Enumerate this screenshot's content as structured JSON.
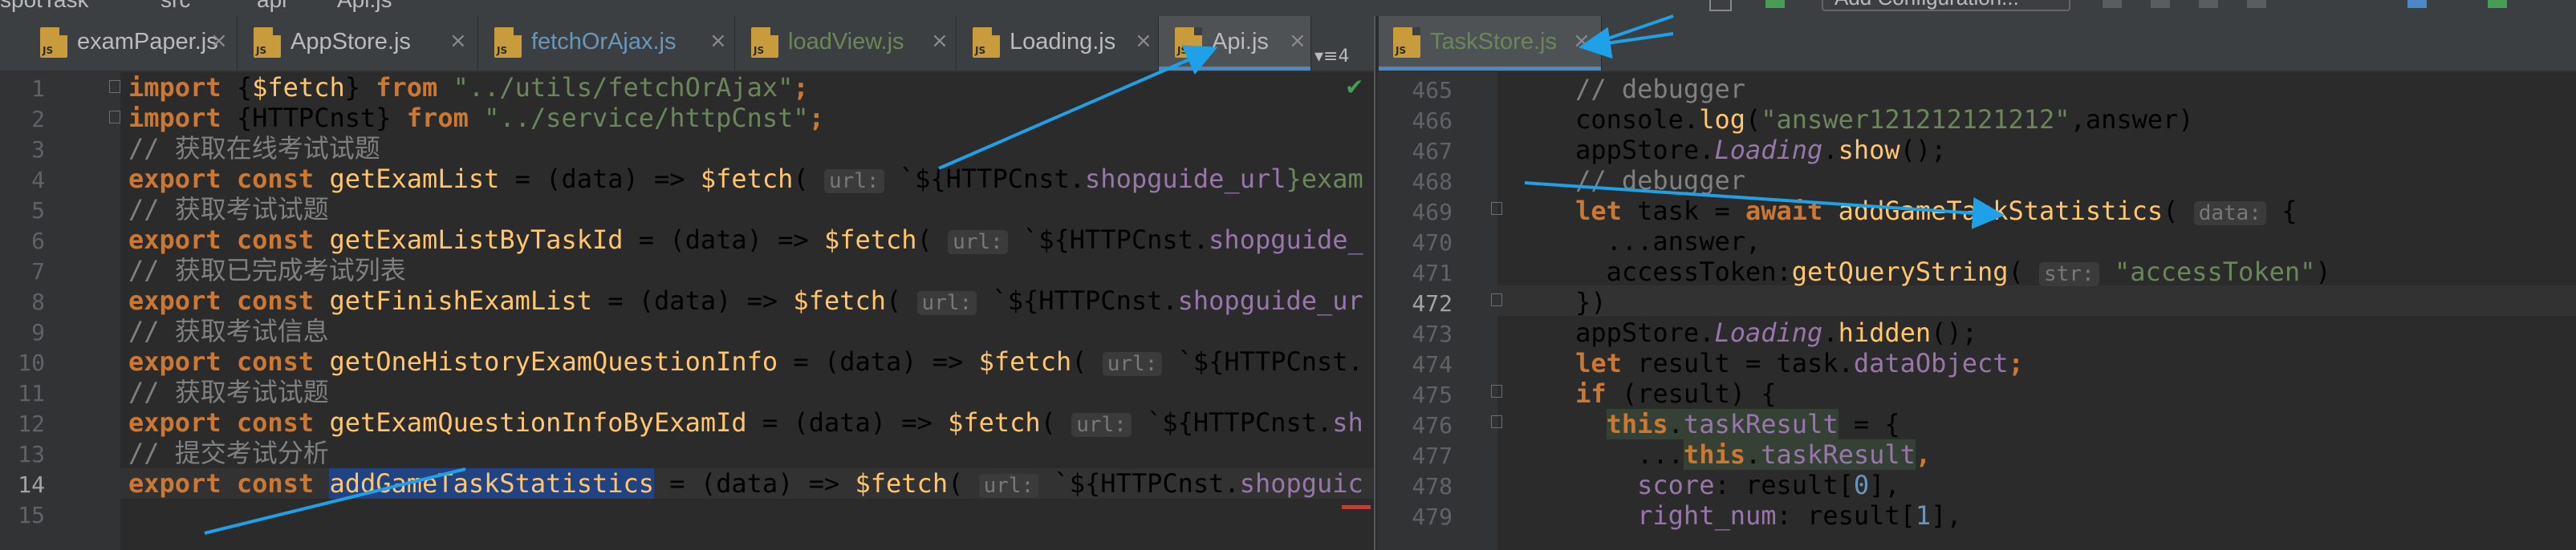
{
  "title_bar": {
    "crumbs": [
      "spotTask",
      "src",
      "api",
      "Api.js"
    ],
    "run_config": "Add Configuration..."
  },
  "left_tabs": [
    {
      "name": "examPaper.js",
      "active": false
    },
    {
      "name": "AppStore.js",
      "active": false
    },
    {
      "name": "fetchOrAjax.js",
      "active": false
    },
    {
      "name": "loadView.js",
      "active": false
    },
    {
      "name": "Loading.js",
      "active": false
    },
    {
      "name": "Api.js",
      "active": true
    }
  ],
  "right_tabs": [
    {
      "name": "TaskStore.js",
      "active": true
    }
  ],
  "tab_icon_text": "JS",
  "tab_close": "×",
  "tab_menu": "▾≡4",
  "left_editor": {
    "line_numbers": [
      "1",
      "2",
      "3",
      "4",
      "5",
      "6",
      "7",
      "8",
      "9",
      "10",
      "11",
      "12",
      "13",
      "14",
      "15"
    ],
    "current_line": "14",
    "lines": [
      [
        {
          "t": "import ",
          "c": "kw"
        },
        {
          "t": "{",
          "c": ""
        },
        {
          "t": "$fetch",
          "c": "fn"
        },
        {
          "t": "} ",
          "c": ""
        },
        {
          "t": "from ",
          "c": "kw"
        },
        {
          "t": "\"../utils/fetchOrAjax\"",
          "c": "str"
        },
        {
          "t": ";",
          "c": "kw"
        }
      ],
      [
        {
          "t": "import ",
          "c": "kw"
        },
        {
          "t": "{HTTPCnst} ",
          "c": ""
        },
        {
          "t": "from ",
          "c": "kw"
        },
        {
          "t": "\"../service/httpCnst\"",
          "c": "str"
        },
        {
          "t": ";",
          "c": "kw"
        }
      ],
      [
        {
          "t": "// 获取在线考试试题",
          "c": "cm"
        }
      ],
      [
        {
          "t": "export const ",
          "c": "kw"
        },
        {
          "t": "getExamList",
          "c": "fn"
        },
        {
          "t": " = (data) => ",
          "c": ""
        },
        {
          "t": "$fetch",
          "c": "fn"
        },
        {
          "t": "( ",
          "c": ""
        },
        {
          "t": "url:",
          "c": "hint"
        },
        {
          "t": " `${HTTPCnst.",
          "c": ""
        },
        {
          "t": "shopguide_url",
          "c": "prop"
        },
        {
          "t": "}exam",
          "c": "str"
        }
      ],
      [
        {
          "t": "// 获取考试试题",
          "c": "cm"
        }
      ],
      [
        {
          "t": "export const ",
          "c": "kw"
        },
        {
          "t": "getExamListByTaskId",
          "c": "fn"
        },
        {
          "t": " = (data) => ",
          "c": ""
        },
        {
          "t": "$fetch",
          "c": "fn"
        },
        {
          "t": "( ",
          "c": ""
        },
        {
          "t": "url:",
          "c": "hint"
        },
        {
          "t": " `${HTTPCnst.",
          "c": ""
        },
        {
          "t": "shopguide_",
          "c": "prop"
        }
      ],
      [
        {
          "t": "// 获取已完成考试列表",
          "c": "cm"
        }
      ],
      [
        {
          "t": "export const ",
          "c": "kw"
        },
        {
          "t": "getFinishExamList",
          "c": "fn"
        },
        {
          "t": " = (data) => ",
          "c": ""
        },
        {
          "t": "$fetch",
          "c": "fn"
        },
        {
          "t": "( ",
          "c": ""
        },
        {
          "t": "url:",
          "c": "hint"
        },
        {
          "t": " `${HTTPCnst.",
          "c": ""
        },
        {
          "t": "shopguide_ur",
          "c": "prop"
        }
      ],
      [
        {
          "t": "// 获取考试信息",
          "c": "cm"
        }
      ],
      [
        {
          "t": "export const ",
          "c": "kw"
        },
        {
          "t": "getOneHistoryExamQuestionInfo",
          "c": "fn"
        },
        {
          "t": " = (data) => ",
          "c": ""
        },
        {
          "t": "$fetch",
          "c": "fn"
        },
        {
          "t": "( ",
          "c": ""
        },
        {
          "t": "url:",
          "c": "hint"
        },
        {
          "t": " `${HTTPCnst.",
          "c": ""
        }
      ],
      [
        {
          "t": "// 获取考试试题",
          "c": "cm"
        }
      ],
      [
        {
          "t": "export const ",
          "c": "kw"
        },
        {
          "t": "getExamQuestionInfoByExamId",
          "c": "fn"
        },
        {
          "t": " = (data) => ",
          "c": ""
        },
        {
          "t": "$fetch",
          "c": "fn"
        },
        {
          "t": "( ",
          "c": ""
        },
        {
          "t": "url:",
          "c": "hint"
        },
        {
          "t": " `${HTTPCnst.",
          "c": ""
        },
        {
          "t": "sh",
          "c": "prop"
        }
      ],
      [
        {
          "t": "// 提交考试分析",
          "c": "cm"
        }
      ],
      [
        {
          "t": "export const ",
          "c": "kw"
        },
        {
          "t": "addGameTaskStatistics",
          "c": "fn sel"
        },
        {
          "t": " = (data) => ",
          "c": ""
        },
        {
          "t": "$fetch",
          "c": "fn"
        },
        {
          "t": "( ",
          "c": ""
        },
        {
          "t": "url:",
          "c": "hint"
        },
        {
          "t": " `${HTTPCnst.",
          "c": ""
        },
        {
          "t": "shopguic",
          "c": "prop"
        }
      ],
      []
    ]
  },
  "right_editor": {
    "line_numbers": [
      "465",
      "466",
      "467",
      "468",
      "469",
      "470",
      "471",
      "472",
      "473",
      "474",
      "475",
      "476",
      "477",
      "478",
      "479"
    ],
    "current_line": "472",
    "lines": [
      [
        {
          "t": "    // debugger",
          "c": "cm"
        }
      ],
      [
        {
          "t": "    console.",
          "c": ""
        },
        {
          "t": "log",
          "c": "fn"
        },
        {
          "t": "(",
          "c": ""
        },
        {
          "t": "\"answer121212121212\"",
          "c": "str"
        },
        {
          "t": ",answer)",
          "c": ""
        }
      ],
      [
        {
          "t": "    appStore.",
          "c": ""
        },
        {
          "t": "Loading",
          "c": "prop ital"
        },
        {
          "t": ".",
          "c": ""
        },
        {
          "t": "show",
          "c": "fn"
        },
        {
          "t": "();",
          "c": ""
        }
      ],
      [
        {
          "t": "    // debugger",
          "c": "cm"
        }
      ],
      [
        {
          "t": "    ",
          "c": ""
        },
        {
          "t": "let ",
          "c": "kw"
        },
        {
          "t": "task = ",
          "c": ""
        },
        {
          "t": "await ",
          "c": "kw"
        },
        {
          "t": "addGameTaskStatistics",
          "c": "fn"
        },
        {
          "t": "( ",
          "c": ""
        },
        {
          "t": "data:",
          "c": "hint"
        },
        {
          "t": " {",
          "c": ""
        }
      ],
      [
        {
          "t": "      ...answer,",
          "c": ""
        }
      ],
      [
        {
          "t": "      accessToken:",
          "c": ""
        },
        {
          "t": "getQueryString",
          "c": "fn"
        },
        {
          "t": "( ",
          "c": ""
        },
        {
          "t": "str:",
          "c": "hint"
        },
        {
          "t": " ",
          "c": ""
        },
        {
          "t": "\"accessToken\"",
          "c": "str"
        },
        {
          "t": ")",
          "c": ""
        }
      ],
      [
        {
          "t": "    })",
          "c": ""
        }
      ],
      [
        {
          "t": "    appStore.",
          "c": ""
        },
        {
          "t": "Loading",
          "c": "prop ital"
        },
        {
          "t": ".",
          "c": ""
        },
        {
          "t": "hidden",
          "c": "fn"
        },
        {
          "t": "();",
          "c": ""
        }
      ],
      [
        {
          "t": "    ",
          "c": ""
        },
        {
          "t": "let ",
          "c": "kw"
        },
        {
          "t": "result = task.",
          "c": ""
        },
        {
          "t": "dataObject",
          "c": "prop"
        },
        {
          "t": ";",
          "c": "kw"
        }
      ],
      [
        {
          "t": "    ",
          "c": ""
        },
        {
          "t": "if ",
          "c": "kw"
        },
        {
          "t": "(result) {",
          "c": ""
        }
      ],
      [
        {
          "t": "      ",
          "c": ""
        },
        {
          "t": "this",
          "c": "kw hl"
        },
        {
          "t": ".",
          "c": "hl"
        },
        {
          "t": "taskResult",
          "c": "prop hl"
        },
        {
          "t": " = {",
          "c": ""
        }
      ],
      [
        {
          "t": "        ...",
          "c": ""
        },
        {
          "t": "this",
          "c": "kw hl"
        },
        {
          "t": ".",
          "c": "hl"
        },
        {
          "t": "taskResult",
          "c": "prop hl"
        },
        {
          "t": ",",
          "c": "kw"
        }
      ],
      [
        {
          "t": "        ",
          "c": ""
        },
        {
          "t": "score",
          "c": "prop"
        },
        {
          "t": ": result[",
          "c": ""
        },
        {
          "t": "0",
          "c": "num"
        },
        {
          "t": "],",
          "c": ""
        }
      ],
      [
        {
          "t": "        ",
          "c": ""
        },
        {
          "t": "right_num",
          "c": "prop"
        },
        {
          "t": ": result[",
          "c": ""
        },
        {
          "t": "1",
          "c": "num"
        },
        {
          "t": "],",
          "c": ""
        }
      ]
    ]
  }
}
